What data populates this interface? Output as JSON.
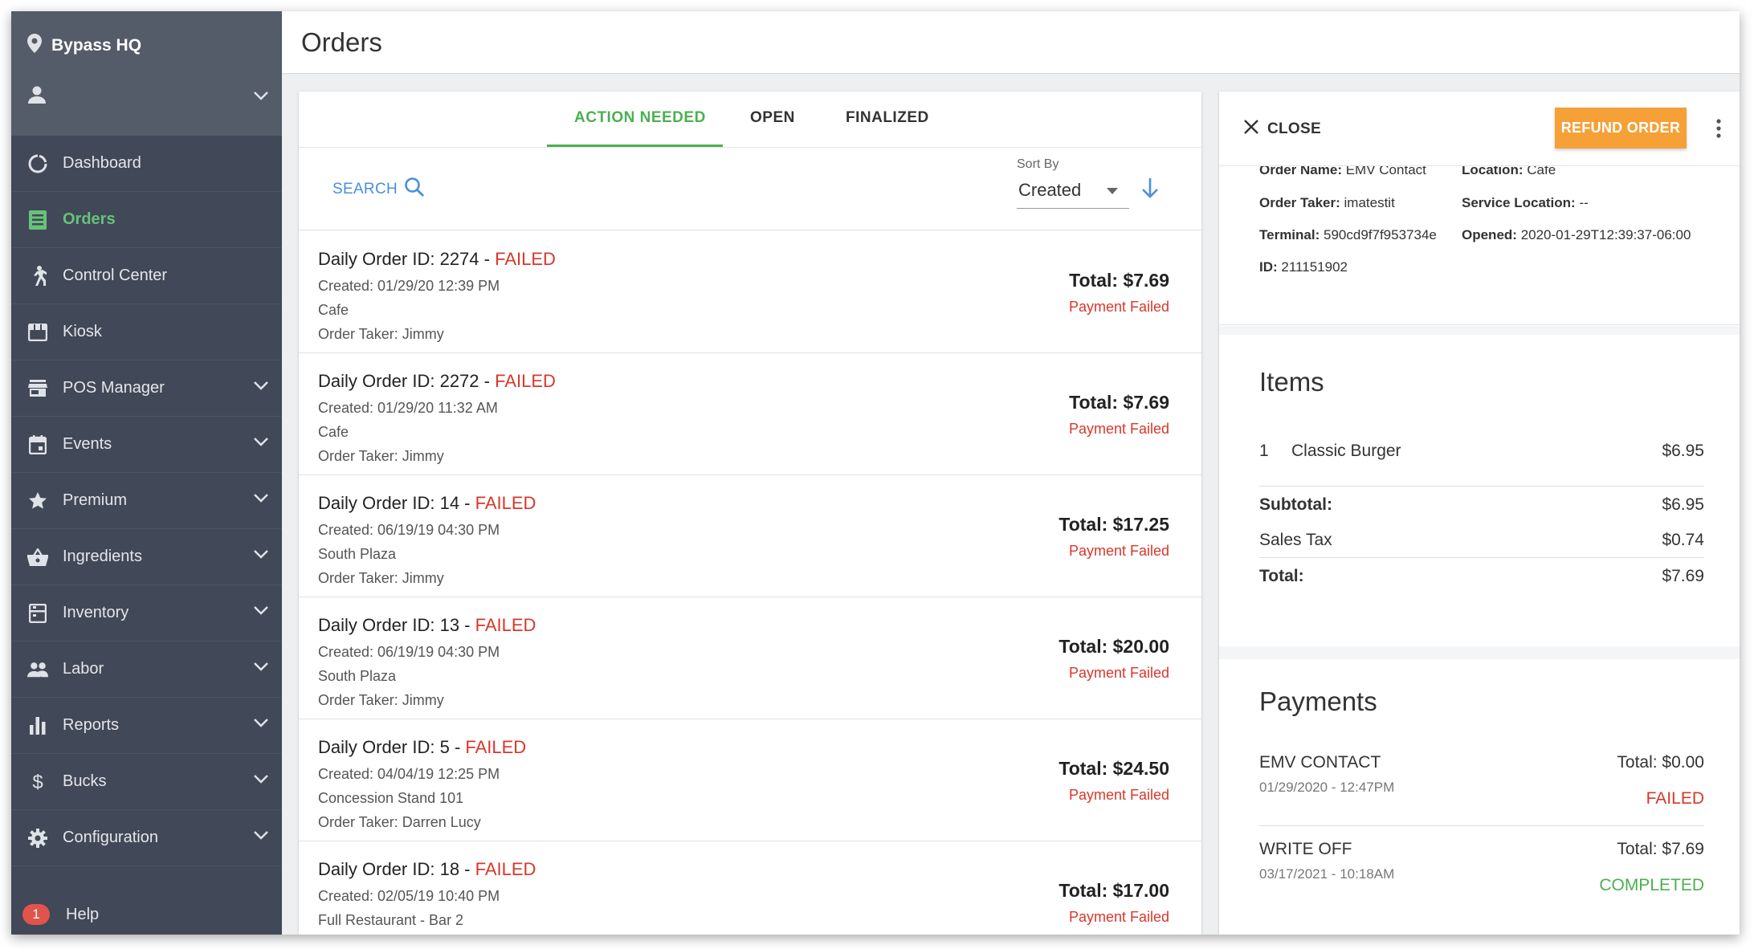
{
  "sidebar": {
    "location": "Bypass HQ",
    "items": [
      {
        "label": "Dashboard"
      },
      {
        "label": "Orders"
      },
      {
        "label": "Control Center"
      },
      {
        "label": "Kiosk"
      },
      {
        "label": "POS Manager"
      },
      {
        "label": "Events"
      },
      {
        "label": "Premium"
      },
      {
        "label": "Ingredients"
      },
      {
        "label": "Inventory"
      },
      {
        "label": "Labor"
      },
      {
        "label": "Reports"
      },
      {
        "label": "Bucks"
      },
      {
        "label": "Configuration"
      }
    ],
    "help": {
      "badge": "1",
      "label": "Help"
    }
  },
  "header": {
    "title": "Orders"
  },
  "orders": {
    "tabs": [
      {
        "label": "ACTION NEEDED"
      },
      {
        "label": "OPEN"
      },
      {
        "label": "FINALIZED"
      }
    ],
    "search_label": "SEARCH",
    "sort": {
      "label": "Sort By",
      "value": "Created"
    },
    "separator": " - ",
    "list": [
      {
        "title": "Daily Order ID: 2274",
        "status": "FAILED",
        "created": "Created: 01/29/20 12:39 PM",
        "location": "Cafe",
        "taker": "Order Taker: Jimmy",
        "total": "Total: $7.69",
        "payment": "Payment Failed"
      },
      {
        "title": "Daily Order ID: 2272",
        "status": "FAILED",
        "created": "Created: 01/29/20 11:32 AM",
        "location": "Cafe",
        "taker": "Order Taker: Jimmy",
        "total": "Total: $7.69",
        "payment": "Payment Failed"
      },
      {
        "title": "Daily Order ID: 14",
        "status": "FAILED",
        "created": "Created: 06/19/19 04:30 PM",
        "location": "South Plaza",
        "taker": "Order Taker: Jimmy",
        "total": "Total: $17.25",
        "payment": "Payment Failed"
      },
      {
        "title": "Daily Order ID: 13",
        "status": "FAILED",
        "created": "Created: 06/19/19 04:30 PM",
        "location": "South Plaza",
        "taker": "Order Taker: Jimmy",
        "total": "Total: $20.00",
        "payment": "Payment Failed"
      },
      {
        "title": "Daily Order ID: 5",
        "status": "FAILED",
        "created": "Created: 04/04/19 12:25 PM",
        "location": "Concession Stand 101",
        "taker": "Order Taker: Darren Lucy",
        "total": "Total: $24.50",
        "payment": "Payment Failed"
      },
      {
        "title": "Daily Order ID: 18",
        "status": "FAILED",
        "created": "Created: 02/05/19 10:40 PM",
        "location": "Full Restaurant - Bar 2",
        "taker": "",
        "total": "Total: $17.00",
        "payment": "Payment Failed"
      }
    ]
  },
  "detail": {
    "close_label": "CLOSE",
    "refund_label": "REFUND ORDER",
    "info": {
      "order_name_label": "Order Name:",
      "order_name": "EMV Contact",
      "location_label": "Location:",
      "location": "Cafe",
      "order_taker_label": "Order Taker:",
      "order_taker": "imatestit",
      "service_location_label": "Service Location:",
      "service_location": "--",
      "terminal_label": "Terminal:",
      "terminal": "590cd9f7f953734e",
      "opened_label": "Opened:",
      "opened": "2020-01-29T12:39:37-06:00",
      "id_label": "ID:",
      "id": "211151902"
    },
    "items": {
      "title": "Items",
      "list": [
        {
          "qty": "1",
          "name": "Classic Burger",
          "price": "$6.95"
        }
      ],
      "subtotal_label": "Subtotal:",
      "subtotal": "$6.95",
      "tax_label": "Sales Tax",
      "tax": "$0.74",
      "total_label": "Total:",
      "total": "$7.69"
    },
    "payments": {
      "title": "Payments",
      "list": [
        {
          "method": "EMV CONTACT",
          "date": "01/29/2020 - 12:47PM",
          "total": "Total: $0.00",
          "status": "FAILED",
          "status_color": "#d9372a"
        },
        {
          "method": "WRITE OFF",
          "date": "03/17/2021 - 10:18AM",
          "total": "Total: $7.69",
          "status": "COMPLETED",
          "status_color": "#4caf50"
        }
      ]
    }
  },
  "colors": {
    "accent": "#4caf50",
    "error": "#d9372a",
    "link": "#4b8fd9",
    "refund": "#f5a138",
    "sidebar": "#414857"
  }
}
